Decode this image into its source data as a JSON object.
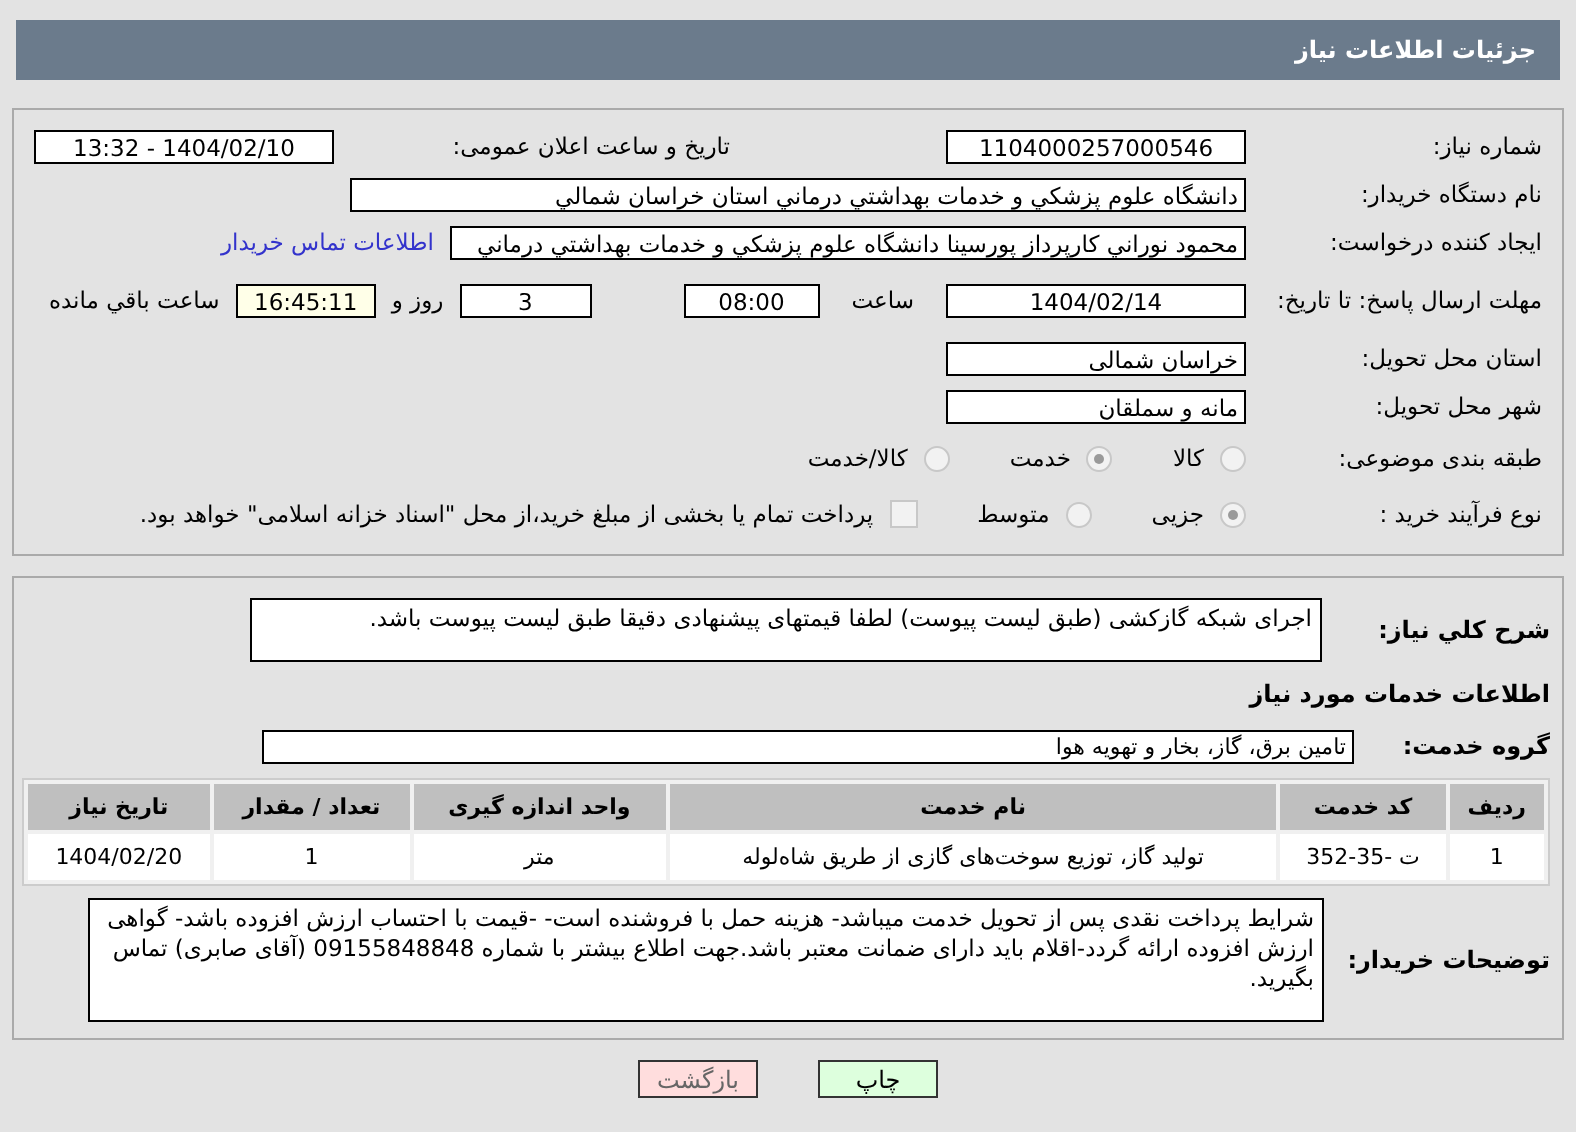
{
  "header": {
    "title": "جزئیات اطلاعات نیاز"
  },
  "need_number": {
    "label": "شماره نیاز:",
    "value": "1104000257000546"
  },
  "announce": {
    "label": "تاریخ و ساعت اعلان عمومی:",
    "value": "1404/02/10 - 13:32"
  },
  "buyer_org": {
    "label": "نام دستگاه خریدار:",
    "value": "دانشگاه علوم پزشکي و خدمات بهداشتي درماني استان خراسان شمالي"
  },
  "requester": {
    "label": "ایجاد کننده درخواست:",
    "value": "محمود نوراني كارپرداز پورسينا دانشگاه علوم پزشكي و خدمات بهداشتي درماني",
    "link": "اطلاعات تماس خریدار"
  },
  "deadline": {
    "label": "مهلت ارسال پاسخ: تا تاریخ:",
    "date": "1404/02/14",
    "time_label": "ساعت",
    "time": "08:00",
    "days": "3",
    "days_label": "روز و",
    "remaining": "16:45:11",
    "remaining_label": "ساعت باقي مانده"
  },
  "province": {
    "label": "استان محل تحویل:",
    "value": "خراسان شمالی"
  },
  "city": {
    "label": "شهر محل تحویل:",
    "value": "مانه و سملقان"
  },
  "category": {
    "label": "طبقه بندی موضوعی:",
    "options": [
      {
        "label": "کالا",
        "selected": false
      },
      {
        "label": "خدمت",
        "selected": true
      },
      {
        "label": "کالا/خدمت",
        "selected": false
      }
    ]
  },
  "process": {
    "label": "نوع فرآیند خرید :",
    "options": [
      {
        "label": "جزیی",
        "selected": true
      },
      {
        "label": "متوسط",
        "selected": false
      }
    ],
    "treasury": {
      "label": "پرداخت تمام یا بخشی از مبلغ خرید،از محل \"اسناد خزانه اسلامی\" خواهد بود.",
      "checked": false
    }
  },
  "description": {
    "label": "شرح کلي نیاز:",
    "value": "اجرای شبکه گازکشی  (طبق لیست پیوست) لطفا قیمتهای پیشنهادی دقیقا طبق لیست پیوست باشد."
  },
  "services_heading": "اطلاعات خدمات مورد نیاز",
  "service_group": {
    "label": "گروه خدمت:",
    "value": "تامین برق، گاز، بخار و تهویه هوا"
  },
  "table": {
    "columns": [
      "ردیف",
      "کد خدمت",
      "نام خدمت",
      "واحد اندازه گیری",
      "تعداد / مقدار",
      "تاریخ نیاز"
    ],
    "rows": [
      [
        "1",
        "ت -35-352",
        "تولید گاز، توزیع سوخت‌های گازی از طریق شاه‌لوله",
        "متر",
        "1",
        "1404/02/20"
      ]
    ]
  },
  "buyer_notes": {
    "label": "توضیحات خریدار:",
    "value": "شرایط پرداخت نقدی پس از تحویل خدمت میباشد- هزینه حمل با فروشنده است- -قیمت با احتساب ارزش افزوده  باشد- گواهی ارزش افزوده ارائه گردد-اقلام باید دارای ضمانت معتبر باشد.جهت اطلاع بیشتر با شماره 09155848848 (آقای صابری) تماس بگیرید."
  },
  "buttons": [
    {
      "label": "چاپ",
      "kind": "print"
    },
    {
      "label": "بازگشت",
      "kind": "back"
    }
  ]
}
